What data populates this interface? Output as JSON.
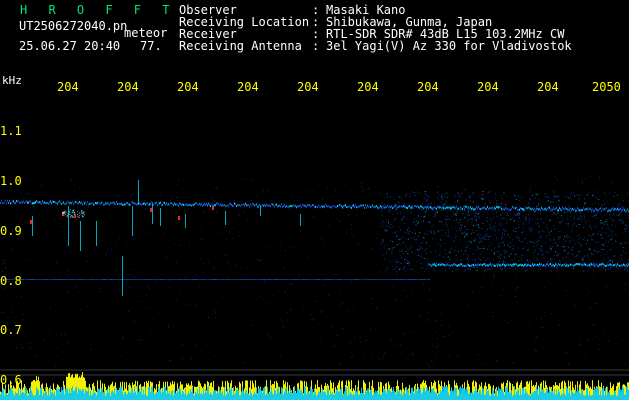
{
  "header": {
    "title": "H R O F F T",
    "filename": "UT2506272040.pn",
    "meteor_label": "meteor",
    "datetime": "25.06.27 20:40",
    "count": "77.",
    "info": [
      {
        "label": "Observer",
        "sep": ":",
        "value": "Masaki Kano"
      },
      {
        "label": "Receiving Location",
        "sep": ":",
        "value": "Shibukawa, Gunma, Japan"
      },
      {
        "label": "Receiver",
        "sep": ":",
        "value": "RTL-SDR SDR# 43dB L15 103.2MHz CW"
      },
      {
        "label": "Receiving Antenna",
        "sep": ":",
        "value": "3el Yagi(V) Az 330 for Vladivostok"
      }
    ]
  },
  "axis": {
    "unit": "kHz",
    "x_ticks": [
      "204",
      "204",
      "204",
      "204",
      "204",
      "204",
      "204",
      "204",
      "204",
      "2050"
    ],
    "y_ticks": [
      "1.1",
      "1.0",
      "0.9",
      "0.8",
      "0.7",
      "0.6"
    ]
  },
  "colors": {
    "background": "#000000",
    "text_white": "#ffffff",
    "title_green": "#00e676",
    "axis_yellow": "#ffff00",
    "echo_blue": "#1e64ff",
    "echo_cyan": "#00e0ff",
    "meteor_red": "#ff3030",
    "level_yellow": "#ffff00",
    "level_cyan": "#00c8ff"
  }
}
